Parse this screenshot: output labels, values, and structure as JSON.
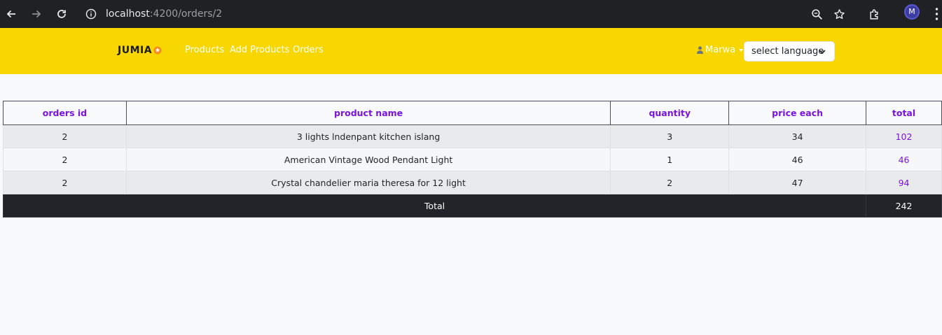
{
  "browser": {
    "url_host": "localhost",
    "url_path": ":4200/orders/2",
    "avatar_letter": "M",
    "icons": [
      "back-icon",
      "forward-icon",
      "reload-icon",
      "info-icon",
      "zoom-icon",
      "star-icon",
      "extensions-icon",
      "kebab-menu-icon"
    ]
  },
  "navbar": {
    "brand": "JUMIA",
    "links": [
      {
        "label": "Products"
      },
      {
        "label": "Add Products"
      },
      {
        "label": "Orders"
      }
    ],
    "user_name": "Marwa",
    "language_select": "select language",
    "colors": {
      "background": "#f8d600",
      "brand_star": "#f68b1e"
    }
  },
  "table": {
    "headers": [
      "orders id",
      "product name",
      "quantity",
      "price each",
      "total"
    ],
    "rows": [
      {
        "order_id": "2",
        "product_name": "3 lights lndenpant kitchen islang",
        "quantity": "3",
        "price_each": "34",
        "total": "102"
      },
      {
        "order_id": "2",
        "product_name": "American Vintage Wood Pendant Light",
        "quantity": "1",
        "price_each": "46",
        "total": "46"
      },
      {
        "order_id": "2",
        "product_name": "Crystal chandelier maria theresa for 12 light",
        "quantity": "2",
        "price_each": "47",
        "total": "94"
      }
    ],
    "footer": {
      "label": "Total",
      "value": "242"
    },
    "colors": {
      "header_text": "#7a12e0",
      "footer_bg": "#212529"
    }
  }
}
